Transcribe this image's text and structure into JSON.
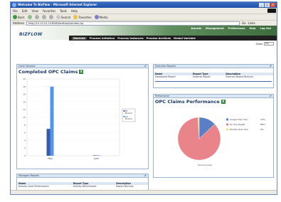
{
  "window": {
    "title": "Welcome To BizFlow - Microsoft Internet Explorer"
  },
  "menu": [
    "File",
    "Edit",
    "View",
    "Favorites",
    "Tools",
    "Help"
  ],
  "toolbar": {
    "back": "Back",
    "search": "Search",
    "favorites": "Favorites",
    "media": "Media"
  },
  "address": {
    "label": "Address",
    "url": "http://10.10.10.10:8080/bizflow/bizindex.jsp",
    "go": "Go",
    "links": "Links"
  },
  "app": {
    "logo": "BIZFLOW",
    "top_links": [
      "Awards",
      "Management",
      "Preferences",
      "Help",
      "Log Out"
    ],
    "nav": [
      "Worklist",
      "Process Initiation",
      "Process Instances",
      "Process Archives",
      "Global Variable"
    ],
    "show_label": "Show",
    "show_value": "File"
  },
  "claims": {
    "header": "Claim Volumes",
    "title": "Completed OPC Claims",
    "legend": [
      "NY Branch",
      "CA Branch"
    ],
    "y_ticks": [
      "20",
      "18",
      "16",
      "14",
      "12",
      "10",
      "8",
      "6",
      "4",
      "2",
      "0"
    ]
  },
  "chart_data": [
    {
      "type": "bar",
      "title": "Completed OPC Claims",
      "categories": [
        "May",
        "June"
      ],
      "series": [
        {
          "name": "NY Branch",
          "values": [
            7,
            0
          ]
        },
        {
          "name": "CA Branch",
          "values": [
            18,
            0
          ]
        }
      ],
      "ylim": [
        0,
        20
      ],
      "legend": "right"
    },
    {
      "type": "pie",
      "title": "OPC Claims Performance",
      "xlabel": "Service Level",
      "labels": [
        "Longer than SLA",
        "On SLA Target",
        "Shorter than SLA"
      ],
      "values": [
        13,
        86,
        1
      ],
      "value_labels": [
        "13%",
        "86%",
        "0%"
      ],
      "colors": [
        "#5b7fc7",
        "#e8848a",
        "#f2e27a"
      ]
    }
  ],
  "execution_reports": {
    "header": "Execution Reports",
    "columns": [
      "Name",
      "Report Type",
      "Description"
    ],
    "rows": [
      [
        "Dashboard Report",
        "External Report",
        "External Report BizCove"
      ]
    ]
  },
  "performance": {
    "header": "Performance",
    "title": "OPC Claims Performance",
    "legend": [
      "Longer than SLA",
      "On SLA Target",
      "Shorter than SLA"
    ],
    "pct": [
      "13%",
      "86%",
      "0%"
    ],
    "xlabel": "Service Level"
  },
  "managers_reports": {
    "header": "Managers Reports",
    "columns": [
      "Name",
      "Report Type",
      "Description"
    ],
    "rows": [
      [
        "Activity Level Performance",
        "Activity Benchmarks",
        "Report BizCove"
      ]
    ]
  }
}
